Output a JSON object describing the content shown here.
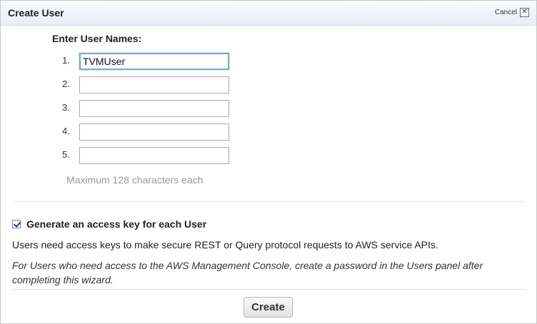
{
  "dialog": {
    "title": "Create User",
    "cancel_label": "Cancel",
    "close_glyph": "✕"
  },
  "form": {
    "section_title": "Enter User Names:",
    "rows": [
      {
        "number": "1.",
        "value": "TVMUser"
      },
      {
        "number": "2.",
        "value": ""
      },
      {
        "number": "3.",
        "value": ""
      },
      {
        "number": "4.",
        "value": ""
      },
      {
        "number": "5.",
        "value": ""
      }
    ],
    "hint": "Maximum 128 characters each"
  },
  "access_key": {
    "checked": true,
    "label": "Generate an access key for each User",
    "info": "Users need access keys to make secure REST or Query protocol requests to AWS service APIs.",
    "console_note": "For Users who need access to the AWS Management Console, create a password in the Users panel after completing this wizard."
  },
  "footer": {
    "create_label": "Create"
  },
  "colors": {
    "titlebar": "#e9eef5",
    "focus_border": "#7aa7d9",
    "hint_text": "#999999",
    "checkbox_mark": "#1e3f91"
  }
}
